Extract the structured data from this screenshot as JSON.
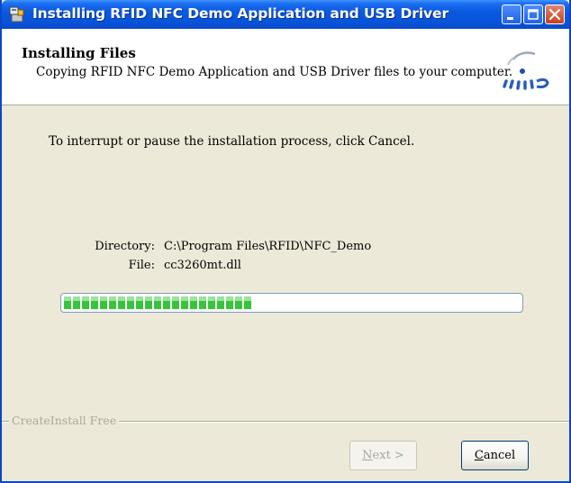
{
  "window": {
    "title": "Installing RFID NFC Demo Application and USB Driver"
  },
  "header": {
    "title": "Installing Files",
    "subtitle": "Copying RFID NFC Demo Application and USB Driver files to your computer."
  },
  "body": {
    "instruction": "To interrupt or pause the installation process, click Cancel.",
    "directory_label": "Directory:",
    "directory_value": "C:\\Program Files\\RFID\\NFC_Demo",
    "file_label": "File:",
    "file_value": "cc3260mt.dll",
    "progress": 0.41
  },
  "footer": {
    "group_label": "CreateInstall Free",
    "next_mnemonic": "N",
    "next_rest": "ext >",
    "cancel_mnemonic": "C",
    "cancel_rest": "ancel"
  },
  "colors": {
    "title_bar": "#0a5ae0",
    "progress_fill": "#37c43a",
    "dialog_bg": "#ece9d8"
  },
  "icons": {
    "app": "installer-icon",
    "logo": "createinstall-logo",
    "minimize": "minimize-icon",
    "maximize": "maximize-icon",
    "close": "close-icon"
  }
}
